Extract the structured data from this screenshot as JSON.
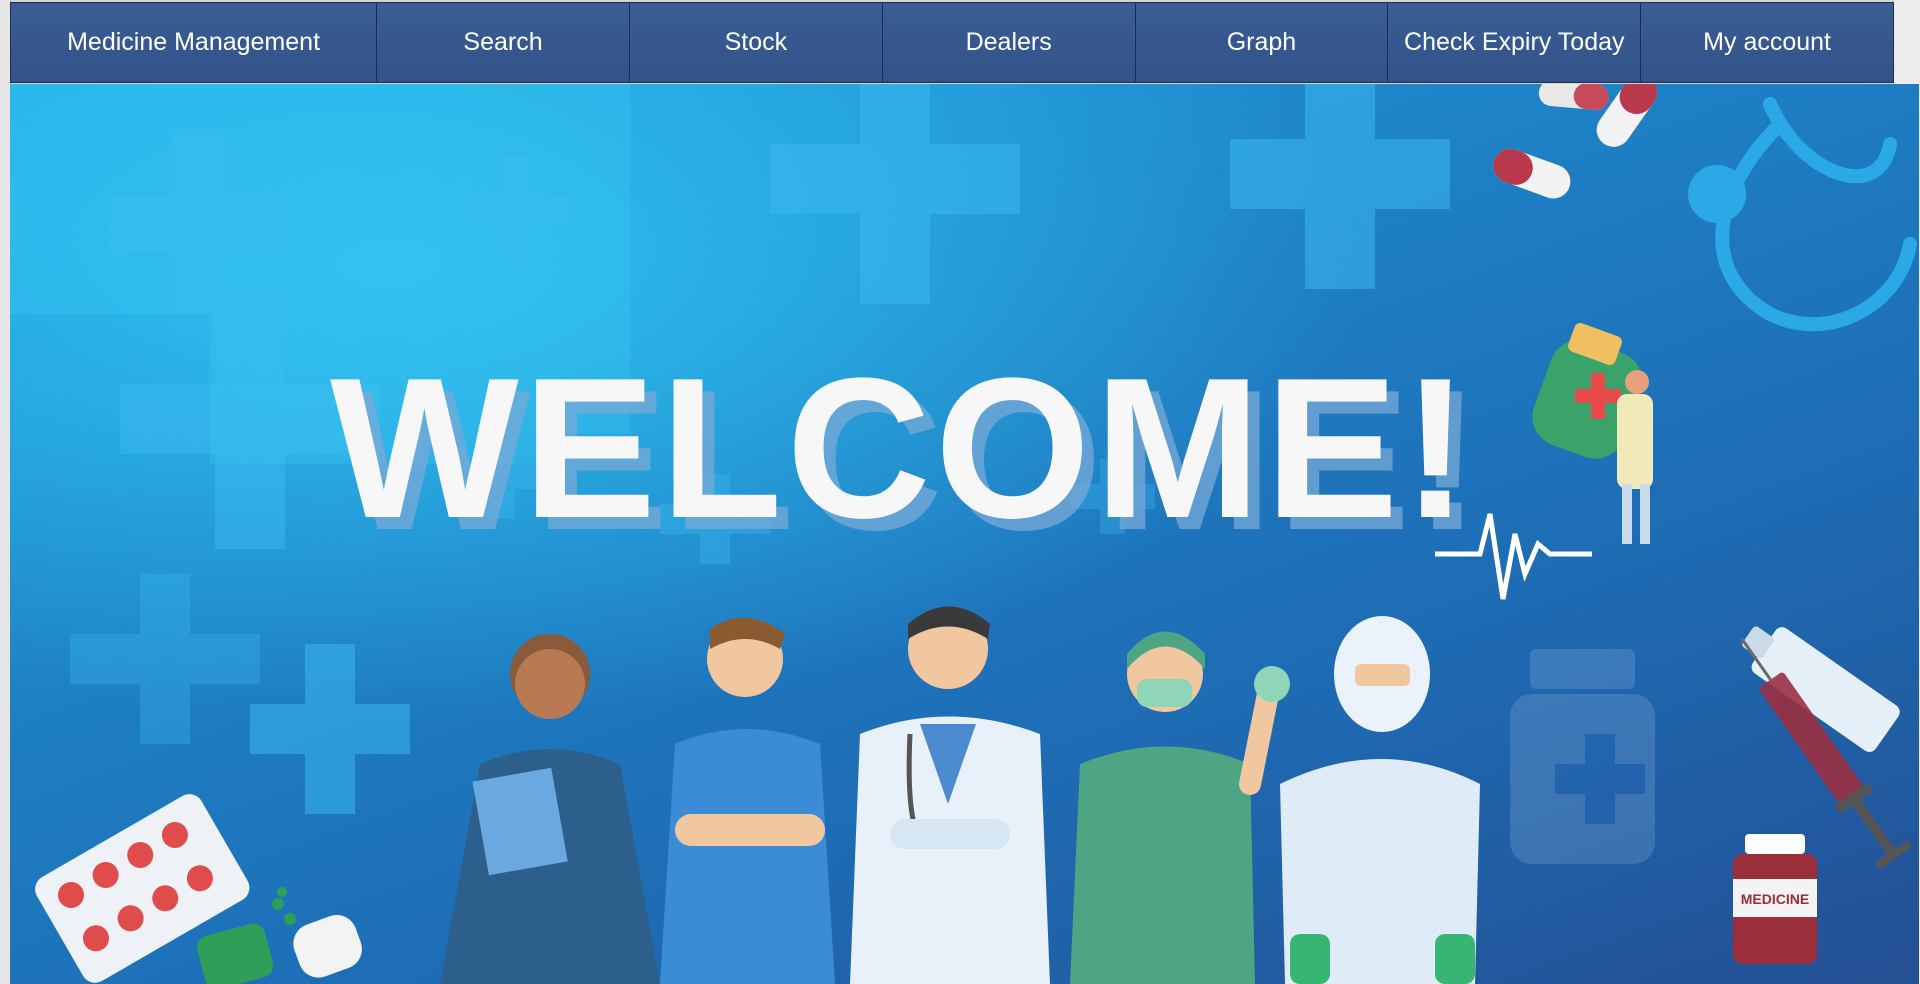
{
  "window": {
    "title": "Medicine Management"
  },
  "menu": {
    "items": [
      {
        "label": "Medicine Management"
      },
      {
        "label": "Search"
      },
      {
        "label": "Stock"
      },
      {
        "label": "Dealers"
      },
      {
        "label": "Graph"
      },
      {
        "label": "Check Expiry Today"
      },
      {
        "label": "My account"
      }
    ]
  },
  "hero": {
    "welcome": "WELCOME!",
    "bottle_label": "MEDICINE"
  },
  "colors": {
    "menu_bg": "#34568a",
    "menu_text": "#ffffff",
    "hero_top": "#2fc1f0",
    "hero_bottom": "#244f93"
  }
}
